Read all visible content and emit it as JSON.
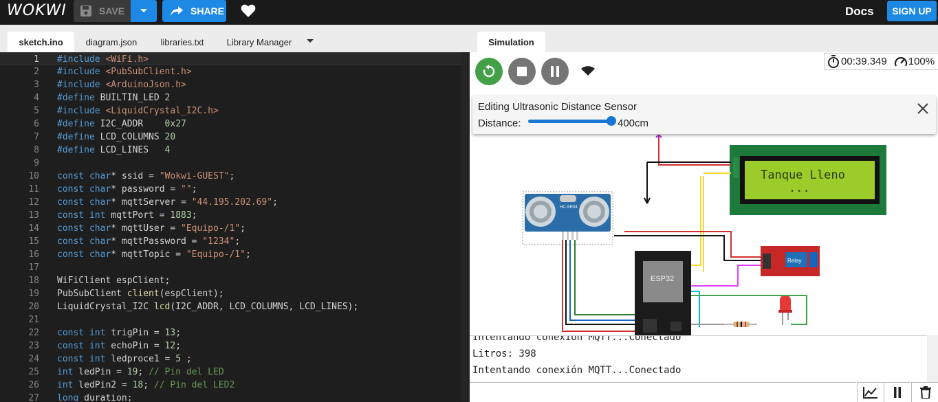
{
  "app": {
    "logo": "WOKWI"
  },
  "toolbar": {
    "save_label": "SAVE",
    "share_label": "SHARE",
    "docs_label": "Docs",
    "signup_label": "SIGN UP"
  },
  "editor_tabs": [
    {
      "label": "sketch.ino",
      "active": true
    },
    {
      "label": "diagram.json",
      "active": false
    },
    {
      "label": "libraries.txt",
      "active": false
    },
    {
      "label": "Library Manager",
      "active": false
    }
  ],
  "editor": {
    "current_line": 1,
    "lines": [
      {
        "n": "1",
        "html": "<span class='kw'>#include</span> <span class='str'>&lt;WiFi.h&gt;</span>"
      },
      {
        "n": "2",
        "html": "<span class='kw'>#include</span> <span class='str'>&lt;PubSubClient.h&gt;</span>"
      },
      {
        "n": "3",
        "html": "<span class='kw'>#include</span> <span class='str'>&lt;ArduinoJson.h&gt;</span>"
      },
      {
        "n": "4",
        "html": "<span class='kw'>#define</span> BUILTIN_LED <span class='num'>2</span>"
      },
      {
        "n": "5",
        "html": "<span class='kw'>#include</span> <span class='str'>&lt;LiquidCrystal_I2C.h&gt;</span>"
      },
      {
        "n": "6",
        "html": "<span class='kw'>#define</span> I2C_ADDR    <span class='num'>0x27</span>"
      },
      {
        "n": "7",
        "html": "<span class='kw'>#define</span> LCD_COLUMNS <span class='num'>20</span>"
      },
      {
        "n": "8",
        "html": "<span class='kw'>#define</span> LCD_LINES   <span class='num'>4</span>"
      },
      {
        "n": "9",
        "html": ""
      },
      {
        "n": "10",
        "html": "<span class='kw'>const</span> <span class='kw'>char</span>* ssid = <span class='str'>\"Wokwi-GUEST\"</span>;"
      },
      {
        "n": "11",
        "html": "<span class='kw'>const</span> <span class='kw'>char</span>* password = <span class='str'>\"\"</span>;"
      },
      {
        "n": "12",
        "html": "<span class='kw'>const</span> <span class='kw'>char</span>* mqttServer = <span class='str'>\"44.195.202.69\"</span>;"
      },
      {
        "n": "13",
        "html": "<span class='kw'>const</span> <span class='kw'>int</span> mqttPort = <span class='num'>1883</span>;"
      },
      {
        "n": "14",
        "html": "<span class='kw'>const</span> <span class='kw'>char</span>* mqttUser = <span class='str'>\"Equipo-/1\"</span>;"
      },
      {
        "n": "15",
        "html": "<span class='kw'>const</span> <span class='kw'>char</span>* mqttPassword = <span class='str'>\"1234\"</span>;"
      },
      {
        "n": "16",
        "html": "<span class='kw'>const</span> <span class='kw'>char</span>* mqttTopic = <span class='str'>\"Equipo-/1\"</span>;"
      },
      {
        "n": "17",
        "html": ""
      },
      {
        "n": "18",
        "html": "WiFiClient espClient;"
      },
      {
        "n": "19",
        "html": "PubSubClient <span class='fn'>client</span>(espClient);"
      },
      {
        "n": "20",
        "html": "LiquidCrystal_I2C <span class='fn'>lcd</span>(I2C_ADDR, LCD_COLUMNS, LCD_LINES);"
      },
      {
        "n": "21",
        "html": ""
      },
      {
        "n": "22",
        "html": "<span class='kw'>const</span> <span class='kw'>int</span> trigPin = <span class='num'>13</span>;"
      },
      {
        "n": "23",
        "html": "<span class='kw'>const</span> <span class='kw'>int</span> echoPin = <span class='num'>12</span>;"
      },
      {
        "n": "24",
        "html": "<span class='kw'>const</span> <span class='kw'>int</span> ledproce1 = <span class='num'>5</span> ;"
      },
      {
        "n": "25",
        "html": "<span class='kw'>int</span> ledPin = <span class='num'>19</span>; <span class='cmt'>// Pin del LED</span>"
      },
      {
        "n": "26",
        "html": "<span class='kw'>int</span> ledPin2 = <span class='num'>18</span>; <span class='cmt'>// Pin del LED2</span>"
      },
      {
        "n": "27",
        "html": "<span class='kw'>long</span> duration;"
      }
    ]
  },
  "simulation": {
    "tab_label": "Simulation",
    "timer": "00:39.349",
    "speed": "100%",
    "panel": {
      "title": "Editing Ultrasonic Distance Sensor",
      "label": "Distance:",
      "value": "400cm",
      "slider_fraction": 1.0
    },
    "lcd_line1": "Tanque  Lleno",
    "lcd_line2": "...",
    "chip_label": "ESP32",
    "relay_label": "Relay",
    "sensor_label": "HC-SR04"
  },
  "serial": {
    "lines": [
      "Intentando conexión MQTT...Conectado",
      "Litros: 398",
      "Intentando conexión MQTT...Conectado"
    ]
  },
  "colors": {
    "accent": "#1e88e5",
    "restart": "#43a047",
    "control": "#757575"
  }
}
